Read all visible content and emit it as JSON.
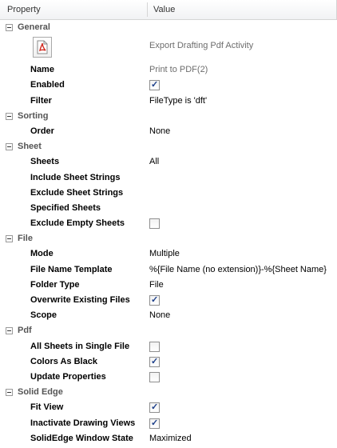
{
  "header": {
    "property": "Property",
    "value": "Value"
  },
  "categories": {
    "general": "General",
    "sorting": "Sorting",
    "sheet": "Sheet",
    "file": "File",
    "pdf": "Pdf",
    "solid_edge": "Solid Edge"
  },
  "general": {
    "icon": "pdf-icon",
    "activity": "Export Drafting Pdf Activity",
    "name_label": "Name",
    "name_value": "Print to PDF(2)",
    "enabled_label": "Enabled",
    "enabled_checked": true,
    "filter_label": "Filter",
    "filter_value": "FileType is 'dft'"
  },
  "sorting": {
    "order_label": "Order",
    "order_value": "None"
  },
  "sheet": {
    "sheets_label": "Sheets",
    "sheets_value": "All",
    "include_label": "Include Sheet Strings",
    "exclude_label": "Exclude Sheet Strings",
    "specified_label": "Specified Sheets",
    "exclude_empty_label": "Exclude Empty Sheets",
    "exclude_empty_checked": false
  },
  "file": {
    "mode_label": "Mode",
    "mode_value": "Multiple",
    "template_label": "File Name Template",
    "template_value": "%{File Name (no extension)}-%{Sheet Name}",
    "folder_label": "Folder Type",
    "folder_value": "File",
    "overwrite_label": "Overwrite Existing Files",
    "overwrite_checked": true,
    "scope_label": "Scope",
    "scope_value": "None"
  },
  "pdf": {
    "single_label": "All Sheets in Single File",
    "single_checked": false,
    "black_label": "Colors As Black",
    "black_checked": true,
    "update_label": "Update Properties",
    "update_checked": false
  },
  "solid_edge": {
    "fit_label": "Fit View",
    "fit_checked": true,
    "inactivate_label": "Inactivate Drawing Views",
    "inactivate_checked": true,
    "window_label": "SolidEdge Window State",
    "window_value": "Maximized"
  }
}
